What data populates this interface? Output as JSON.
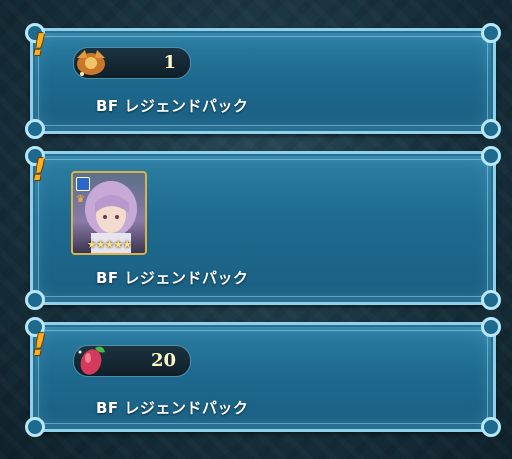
{
  "cards": [
    {
      "reward_type": "item",
      "icon": "dragon-emblem-icon",
      "quantity": "1",
      "label": "BF レジェンドパック"
    },
    {
      "reward_type": "hero",
      "icon": "hero-portrait",
      "rarity": 5,
      "stars": "★★★★★",
      "label": "BF レジェンドパック"
    },
    {
      "reward_type": "item",
      "icon": "divine-fruit-icon",
      "quantity": "20",
      "label": "BF レジェンドパック"
    }
  ],
  "alert_mark": "!",
  "colors": {
    "panel": "#1e6a8f",
    "border": "#8fd0ea",
    "alert": "#ffb020",
    "quantity": "#fff6c8"
  }
}
